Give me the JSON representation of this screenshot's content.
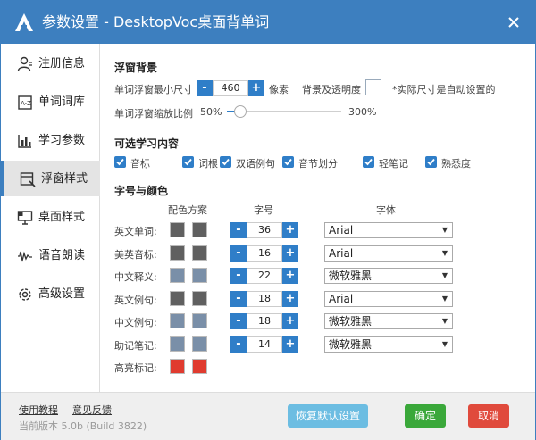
{
  "window": {
    "title": "参数设置 - DesktopVoc桌面背单词"
  },
  "sidebar": {
    "items": [
      {
        "label": "注册信息",
        "icon": "user-icon"
      },
      {
        "label": "单词词库",
        "icon": "book-icon"
      },
      {
        "label": "学习参数",
        "icon": "chart-icon"
      },
      {
        "label": "浮窗样式",
        "icon": "window-icon",
        "active": true
      },
      {
        "label": "桌面样式",
        "icon": "desktop-icon"
      },
      {
        "label": "语音朗读",
        "icon": "waveform-icon"
      },
      {
        "label": "高级设置",
        "icon": "gear-icon"
      }
    ]
  },
  "float_bg": {
    "title": "浮窗背景",
    "min_size_label": "单词浮窗最小尺寸",
    "min_size_value": "460",
    "unit": "像素",
    "bg_label": "背景及透明度",
    "note": "*实际尺寸是自动设置的",
    "scale_label": "单词浮窗缩放比例",
    "scale_min": "50%",
    "scale_max": "300%",
    "scale_fraction": 0.12
  },
  "content_select": {
    "title": "可选学习内容",
    "options": [
      {
        "label": "音标",
        "checked": true
      },
      {
        "label": "词根",
        "checked": true
      },
      {
        "label": "双语例句",
        "checked": true
      },
      {
        "label": "音节划分",
        "checked": true
      },
      {
        "label": "轻笔记",
        "checked": true
      },
      {
        "label": "熟悉度",
        "checked": true
      }
    ]
  },
  "font_color": {
    "title": "字号与颜色",
    "headers": {
      "colors": "配色方案",
      "size": "字号",
      "font": "字体"
    },
    "rows": [
      {
        "label": "英文单词:",
        "c1": "#606060",
        "c2": "#606060",
        "size": "36",
        "font": "Arial"
      },
      {
        "label": "美英音标:",
        "c1": "#606060",
        "c2": "#606060",
        "size": "16",
        "font": "Arial"
      },
      {
        "label": "中文释义:",
        "c1": "#7a8fa8",
        "c2": "#7a8fa8",
        "size": "22",
        "font": "微软雅黑"
      },
      {
        "label": "英文例句:",
        "c1": "#606060",
        "c2": "#606060",
        "size": "18",
        "font": "Arial"
      },
      {
        "label": "中文例句:",
        "c1": "#7a8fa8",
        "c2": "#7a8fa8",
        "size": "18",
        "font": "微软雅黑"
      },
      {
        "label": "助记笔记:",
        "c1": "#7a8fa8",
        "c2": "#7a8fa8",
        "size": "14",
        "font": "微软雅黑"
      },
      {
        "label": "高亮标记:",
        "c1": "#e03b2f",
        "c2": "#e03b2f"
      }
    ]
  },
  "footer": {
    "tutorial": "使用教程",
    "feedback": "意见反馈",
    "version": "当前版本 5.0b (Build 3822)",
    "restore": "恢复默认设置",
    "ok": "确定",
    "cancel": "取消"
  },
  "colors": {
    "brand": "#3d7fbf",
    "accent": "#2f7ec8",
    "ok": "#3aa83a",
    "cancel": "#e04a3c",
    "restore": "#6cbde2"
  }
}
